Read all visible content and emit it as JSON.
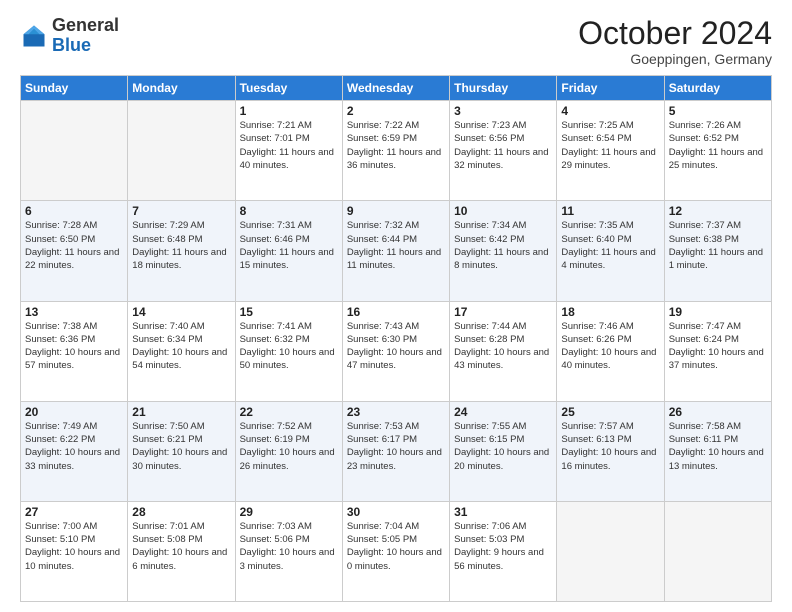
{
  "header": {
    "logo_general": "General",
    "logo_blue": "Blue",
    "month_year": "October 2024",
    "location": "Goeppingen, Germany"
  },
  "days_of_week": [
    "Sunday",
    "Monday",
    "Tuesday",
    "Wednesday",
    "Thursday",
    "Friday",
    "Saturday"
  ],
  "weeks": [
    [
      {
        "day": "",
        "empty": true
      },
      {
        "day": "",
        "empty": true
      },
      {
        "day": "1",
        "sunrise": "7:21 AM",
        "sunset": "7:01 PM",
        "daylight": "11 hours and 40 minutes."
      },
      {
        "day": "2",
        "sunrise": "7:22 AM",
        "sunset": "6:59 PM",
        "daylight": "11 hours and 36 minutes."
      },
      {
        "day": "3",
        "sunrise": "7:23 AM",
        "sunset": "6:56 PM",
        "daylight": "11 hours and 32 minutes."
      },
      {
        "day": "4",
        "sunrise": "7:25 AM",
        "sunset": "6:54 PM",
        "daylight": "11 hours and 29 minutes."
      },
      {
        "day": "5",
        "sunrise": "7:26 AM",
        "sunset": "6:52 PM",
        "daylight": "11 hours and 25 minutes."
      }
    ],
    [
      {
        "day": "6",
        "sunrise": "7:28 AM",
        "sunset": "6:50 PM",
        "daylight": "11 hours and 22 minutes."
      },
      {
        "day": "7",
        "sunrise": "7:29 AM",
        "sunset": "6:48 PM",
        "daylight": "11 hours and 18 minutes."
      },
      {
        "day": "8",
        "sunrise": "7:31 AM",
        "sunset": "6:46 PM",
        "daylight": "11 hours and 15 minutes."
      },
      {
        "day": "9",
        "sunrise": "7:32 AM",
        "sunset": "6:44 PM",
        "daylight": "11 hours and 11 minutes."
      },
      {
        "day": "10",
        "sunrise": "7:34 AM",
        "sunset": "6:42 PM",
        "daylight": "11 hours and 8 minutes."
      },
      {
        "day": "11",
        "sunrise": "7:35 AM",
        "sunset": "6:40 PM",
        "daylight": "11 hours and 4 minutes."
      },
      {
        "day": "12",
        "sunrise": "7:37 AM",
        "sunset": "6:38 PM",
        "daylight": "11 hours and 1 minute."
      }
    ],
    [
      {
        "day": "13",
        "sunrise": "7:38 AM",
        "sunset": "6:36 PM",
        "daylight": "10 hours and 57 minutes."
      },
      {
        "day": "14",
        "sunrise": "7:40 AM",
        "sunset": "6:34 PM",
        "daylight": "10 hours and 54 minutes."
      },
      {
        "day": "15",
        "sunrise": "7:41 AM",
        "sunset": "6:32 PM",
        "daylight": "10 hours and 50 minutes."
      },
      {
        "day": "16",
        "sunrise": "7:43 AM",
        "sunset": "6:30 PM",
        "daylight": "10 hours and 47 minutes."
      },
      {
        "day": "17",
        "sunrise": "7:44 AM",
        "sunset": "6:28 PM",
        "daylight": "10 hours and 43 minutes."
      },
      {
        "day": "18",
        "sunrise": "7:46 AM",
        "sunset": "6:26 PM",
        "daylight": "10 hours and 40 minutes."
      },
      {
        "day": "19",
        "sunrise": "7:47 AM",
        "sunset": "6:24 PM",
        "daylight": "10 hours and 37 minutes."
      }
    ],
    [
      {
        "day": "20",
        "sunrise": "7:49 AM",
        "sunset": "6:22 PM",
        "daylight": "10 hours and 33 minutes."
      },
      {
        "day": "21",
        "sunrise": "7:50 AM",
        "sunset": "6:21 PM",
        "daylight": "10 hours and 30 minutes."
      },
      {
        "day": "22",
        "sunrise": "7:52 AM",
        "sunset": "6:19 PM",
        "daylight": "10 hours and 26 minutes."
      },
      {
        "day": "23",
        "sunrise": "7:53 AM",
        "sunset": "6:17 PM",
        "daylight": "10 hours and 23 minutes."
      },
      {
        "day": "24",
        "sunrise": "7:55 AM",
        "sunset": "6:15 PM",
        "daylight": "10 hours and 20 minutes."
      },
      {
        "day": "25",
        "sunrise": "7:57 AM",
        "sunset": "6:13 PM",
        "daylight": "10 hours and 16 minutes."
      },
      {
        "day": "26",
        "sunrise": "7:58 AM",
        "sunset": "6:11 PM",
        "daylight": "10 hours and 13 minutes."
      }
    ],
    [
      {
        "day": "27",
        "sunrise": "7:00 AM",
        "sunset": "5:10 PM",
        "daylight": "10 hours and 10 minutes."
      },
      {
        "day": "28",
        "sunrise": "7:01 AM",
        "sunset": "5:08 PM",
        "daylight": "10 hours and 6 minutes."
      },
      {
        "day": "29",
        "sunrise": "7:03 AM",
        "sunset": "5:06 PM",
        "daylight": "10 hours and 3 minutes."
      },
      {
        "day": "30",
        "sunrise": "7:04 AM",
        "sunset": "5:05 PM",
        "daylight": "10 hours and 0 minutes."
      },
      {
        "day": "31",
        "sunrise": "7:06 AM",
        "sunset": "5:03 PM",
        "daylight": "9 hours and 56 minutes."
      },
      {
        "day": "",
        "empty": true
      },
      {
        "day": "",
        "empty": true
      }
    ]
  ]
}
